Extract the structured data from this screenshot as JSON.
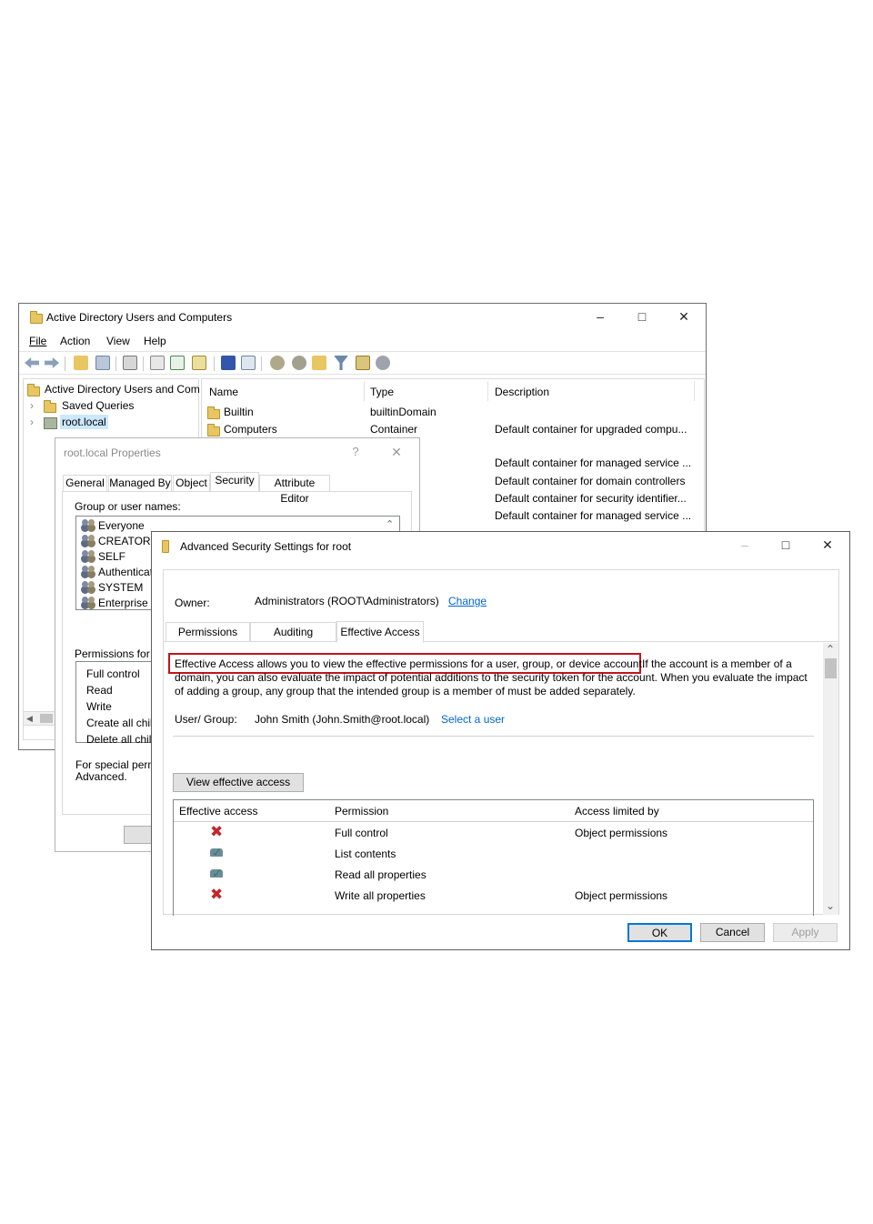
{
  "aduc": {
    "title": "Active Directory Users and Computers",
    "menu": [
      "File",
      "Action",
      "View",
      "Help"
    ],
    "tree": {
      "root": "Active Directory Users and Com",
      "saved_queries": "Saved Queries",
      "domain": "root.local"
    },
    "list": {
      "columns": [
        "Name",
        "Type",
        "Description"
      ],
      "rows": [
        {
          "name": "Builtin",
          "type": "builtinDomain",
          "desc": ""
        },
        {
          "name": "Computers",
          "type": "Container",
          "desc": "Default container for upgraded compu..."
        }
      ],
      "extra_desc": [
        "Default container for managed service ...",
        "Default container for domain controllers",
        "Default container for security identifier...",
        "Default container for managed service ..."
      ]
    }
  },
  "props": {
    "title": "root.local Properties",
    "help_glyph": "?",
    "tabs": [
      "General",
      "Managed By",
      "Object",
      "Security",
      "Attribute Editor"
    ],
    "group_label": "Group or user names:",
    "groups": [
      "Everyone",
      "CREATOR O",
      "SELF",
      "Authenticate",
      "SYSTEM",
      "Enterprise Re"
    ],
    "perm_label": "Permissions for Ev",
    "perms": [
      "Full control",
      "Read",
      "Write",
      "Create all child",
      "Delete all child"
    ],
    "special_line1": "For special permis",
    "special_line2": "Advanced."
  },
  "adv": {
    "title": "Advanced Security Settings for root",
    "owner_label": "Owner:",
    "owner_value": "Administrators (ROOT\\Administrators)",
    "owner_change": "Change",
    "tabs": [
      "Permissions",
      "Auditing",
      "Effective Access"
    ],
    "desc_highlight": "Effective Access allows you to view the effective permissions for a user, group, or device account.",
    "desc_rest1": "If the account is a member of a",
    "desc_line2": "domain, you can also evaluate the impact of potential additions to the security token for the account. When you evaluate the impact",
    "desc_line3": "of adding a group, any group that the intended group is a member of must be added separately.",
    "user_label": "User/ Group:",
    "user_value": "John Smith (John.Smith@root.local)",
    "select_user": "Select a user",
    "view_button": "View effective access",
    "columns": [
      "Effective access",
      "Permission",
      "Access limited by"
    ],
    "rows": [
      {
        "access": "deny",
        "permission": "Full control",
        "limited": "Object permissions"
      },
      {
        "access": "allow",
        "permission": "List contents",
        "limited": ""
      },
      {
        "access": "allow",
        "permission": "Read all properties",
        "limited": ""
      },
      {
        "access": "deny",
        "permission": "Write all properties",
        "limited": "Object permissions"
      }
    ],
    "ok": "OK",
    "cancel": "Cancel",
    "apply": "Apply"
  },
  "colors": {
    "highlight_border": "#c0141c",
    "link": "#0066cc",
    "deny": "#c4262e"
  }
}
